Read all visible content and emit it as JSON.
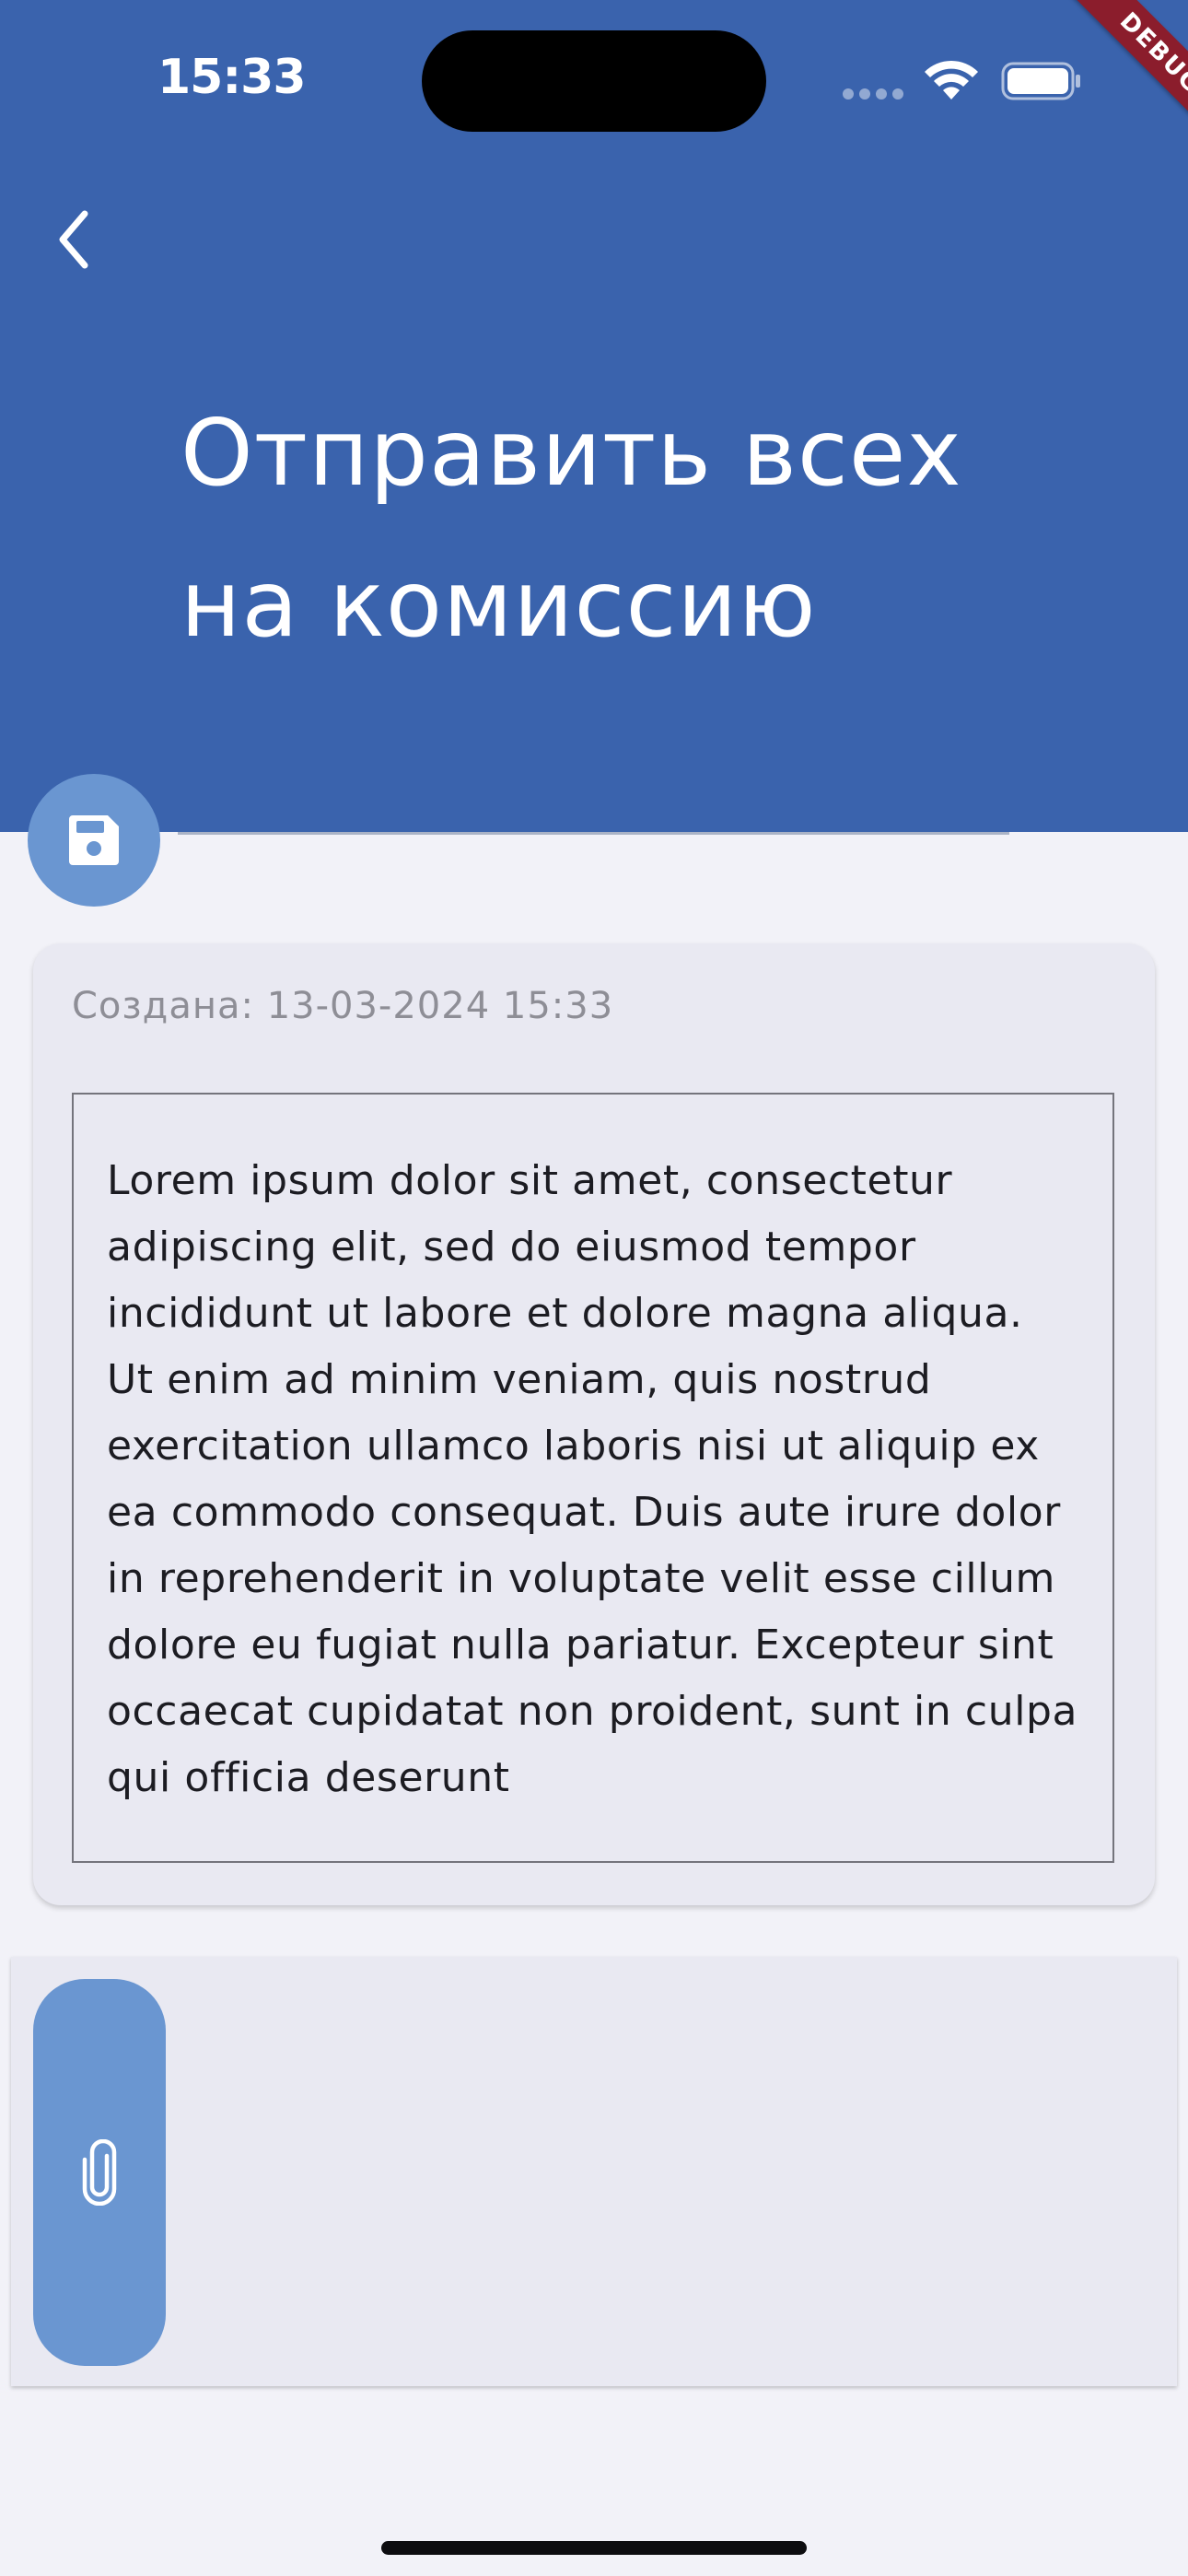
{
  "status_bar": {
    "time": "15:33"
  },
  "debug_banner": "DEBUG",
  "header": {
    "title_line1": "Отправить всех",
    "title_line2": "на комиссию",
    "background_color": "#3a63ad",
    "back_icon": "chevron-left-icon"
  },
  "save_button": {
    "icon": "floppy-disk-icon",
    "color": "#6a96d1"
  },
  "card": {
    "created_label": "Создана: 13-03-2024 15:33",
    "body_text": "Lorem ipsum dolor sit amet, consectetur adipiscing elit, sed do eiusmod tempor incididunt ut labore et dolore magna aliqua. Ut enim ad minim veniam, quis nostrud exercitation ullamco laboris nisi ut aliquip ex ea commodo consequat. Duis aute irure dolor in reprehenderit in voluptate velit esse cillum dolore eu fugiat nulla pariatur. Excepteur sint occaecat cupidatat non proident, sunt in culpa qui officia deserunt"
  },
  "attachments": {
    "attach_icon": "paperclip-icon",
    "color": "#6a96d1"
  }
}
